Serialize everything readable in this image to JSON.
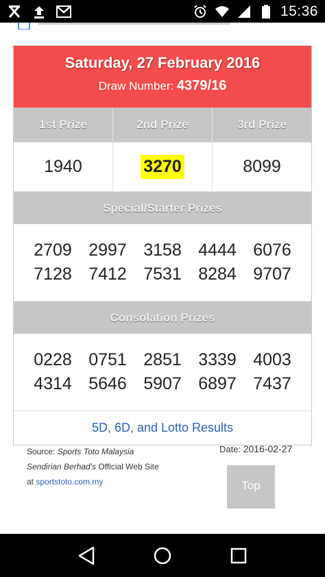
{
  "status_bar": {
    "time": "15:36",
    "icons_left": [
      "x-notification-icon",
      "upload-icon",
      "gmail-icon"
    ],
    "icons_right": [
      "alarm-icon",
      "wifi-icon",
      "signal-icon",
      "battery-icon"
    ]
  },
  "results": {
    "date": "Saturday, 27 February 2016",
    "draw_label": "Draw Number:",
    "draw_number": "4379/16",
    "prize_headers": [
      "1st Prize",
      "2nd Prize",
      "3rd Prize"
    ],
    "prize_values": [
      "1940",
      "3270",
      "8099"
    ],
    "special_title": "Special/Starter Prizes",
    "special_numbers": [
      [
        "2709",
        "2997",
        "3158",
        "4444",
        "6076"
      ],
      [
        "7128",
        "7412",
        "7531",
        "8284",
        "9707"
      ]
    ],
    "consolation_title": "Consolation Prizes",
    "consolation_numbers": [
      [
        "0228",
        "0751",
        "2851",
        "3339",
        "4003"
      ],
      [
        "4314",
        "5646",
        "5907",
        "6897",
        "7437"
      ]
    ],
    "link_text": "5D, 6D, and Lotto Results"
  },
  "footer": {
    "source_prefix": "Source: ",
    "source_name": "Sports Toto Malaysia",
    "source_name_2": "Sendirian Berhad's",
    "source_suffix": " Official Web Site",
    "at_text": "at ",
    "site_link": "sportstoto.com.my",
    "date_label": "Date: ",
    "date_value": "2016-02-27",
    "top_button": "Top"
  },
  "colors": {
    "header_red": "#f44b4b",
    "highlight_yellow": "#ffff00",
    "section_gray": "#c6c6c6",
    "link_blue": "#2a62b8"
  }
}
